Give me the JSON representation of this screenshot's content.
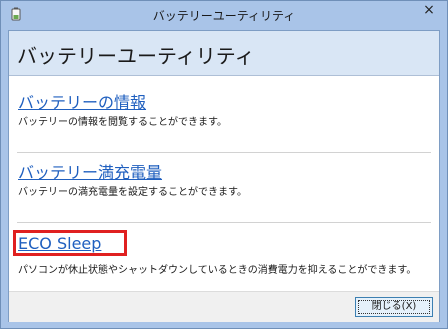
{
  "window": {
    "title": "バッテリーユーティリティ",
    "close_glyph": "×",
    "app_icon": "battery-app-icon"
  },
  "header": {
    "title": "バッテリーユーティリティ"
  },
  "sections": [
    {
      "link": "バッテリーの情報",
      "description": "バッテリーの情報を閲覧することができます。"
    },
    {
      "link": "バッテリー満充電量",
      "description": "バッテリーの満充電量を設定することができます。"
    },
    {
      "link": "ECO Sleep",
      "description": "パソコンが休止状態やシャットダウンしているときの消費電力を抑えることができます。"
    }
  ],
  "footer": {
    "close_label": "閉じる(X)"
  },
  "colors": {
    "link": "#1f5fbf",
    "highlight": "#e02020",
    "frame": "#a9c4e8"
  }
}
